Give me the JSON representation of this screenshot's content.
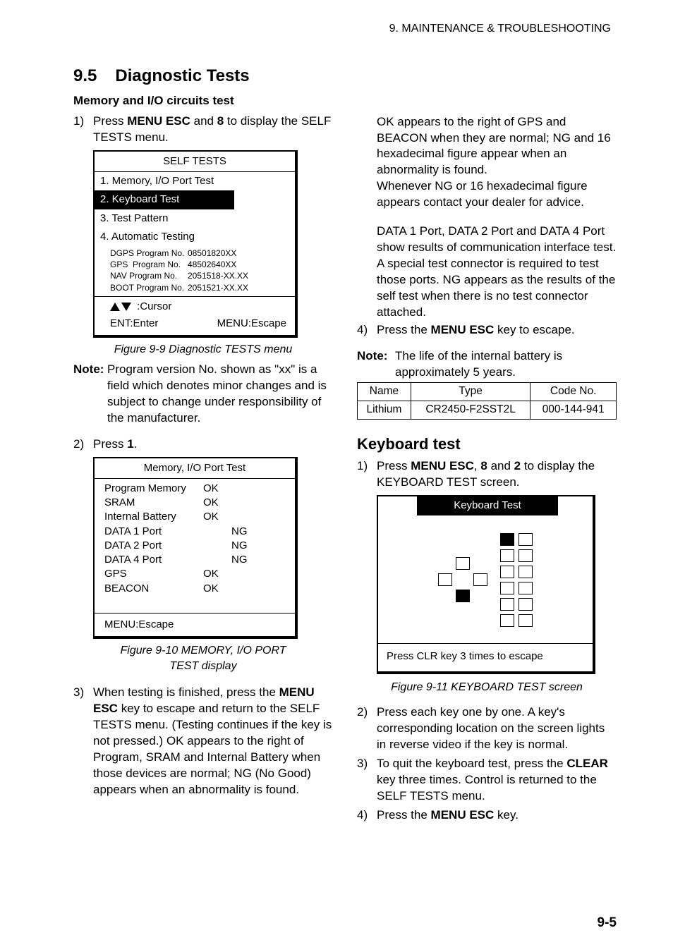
{
  "header": "9. MAINTENANCE & TROUBLESHOOTING",
  "section": {
    "num": "9.5",
    "title": "Diagnostic Tests"
  },
  "sub_mem": "Memory and I/O circuits test",
  "left": {
    "step1_a": "Press ",
    "step1_b": "MENU ESC",
    "step1_c": " and ",
    "step1_d": "8",
    "step1_e": " to display the SELF TESTS menu.",
    "fig9_9": "Figure 9-9 Diagnostic TESTS menu",
    "note1_label": "Note:",
    "note1_body": "Program version No. shown as \"xx\" is a field which denotes minor changes and is subject to change under responsibility of the manufacturer.",
    "step2_a": "Press ",
    "step2_b": "1",
    "step2_c": ".",
    "fig9_10a": "Figure 9-10 MEMORY, I/O PORT",
    "fig9_10b": "TEST display",
    "step3_a": "When testing is finished, press the ",
    "step3_b": "MENU ESC",
    "step3_c": " key to escape and return to the SELF TESTS menu. (Testing continues if the key is not pressed.) OK appears to the right of Program, SRAM and Internal Battery when those devices are normal; NG (No Good) appears when an abnormality is found."
  },
  "self_tests": {
    "title": "SELF TESTS",
    "items": [
      "1. Memory, I/O Port Test",
      "2. Keyboard Test",
      "3. Test Pattern",
      "4. Automatic Testing"
    ],
    "progs": [
      {
        "l": "DGPS Program No.",
        "r": "08501820XX"
      },
      {
        "l": "GPS  Program No.",
        "r": "48502640XX"
      },
      {
        "l": "NAV Program No.",
        "r": "2051518-XX.XX"
      },
      {
        "l": "BOOT Program No.",
        "r": "2051521-XX.XX"
      }
    ],
    "cursor": ":Cursor",
    "ent": "ENT:Enter",
    "esc": "MENU:Escape"
  },
  "mio": {
    "title": "Memory, I/O Port Test",
    "rows": [
      {
        "l": "Program Memory",
        "ok": "OK",
        "ng": ""
      },
      {
        "l": "SRAM",
        "ok": "OK",
        "ng": ""
      },
      {
        "l": "Internal Battery",
        "ok": "OK",
        "ng": ""
      },
      {
        "l": "DATA 1 Port",
        "ok": "",
        "ng": "NG"
      },
      {
        "l": "DATA 2 Port",
        "ok": "",
        "ng": "NG"
      },
      {
        "l": "DATA 4 Port",
        "ok": "",
        "ng": "NG"
      },
      {
        "l": "GPS",
        "ok": "OK",
        "ng": ""
      },
      {
        "l": "BEACON",
        "ok": "OK",
        "ng": ""
      }
    ],
    "foot": "MENU:Escape"
  },
  "right": {
    "cont1": "OK appears to the right of GPS and BEACON when they are normal; NG and 16 hexadecimal figure appear when an abnormality is found.",
    "cont2": "Whenever NG or 16 hexadecimal figure appears contact your dealer for advice.",
    "cont3": "DATA 1 Port, DATA 2 Port and DATA 4 Port show results of communication interface test. A special test connector is required to test those ports. NG appears as the results of the self test when there is no test connector attached.",
    "step4_a": "Press the ",
    "step4_b": "MENU ESC",
    "step4_c": " key to escape.",
    "note_label": "Note:",
    "note_body": "The life of the internal battery is approximately 5 years.",
    "bat": {
      "h1": "Name",
      "h2": "Type",
      "h3": "Code No.",
      "r1": "Lithium",
      "r2": "CR2450-F2SST2L",
      "r3": "000-144-941"
    },
    "kb_title": "Keyboard test",
    "kstep1_a": "Press ",
    "kstep1_b": "MENU ESC",
    "kstep1_c": ", ",
    "kstep1_d": "8",
    "kstep1_e": " and ",
    "kstep1_f": "2",
    "kstep1_g": " to display the KEYBOARD TEST screen.",
    "kbt_title": "Keyboard Test",
    "kbt_foot": "Press CLR key 3 times to escape",
    "fig9_11": "Figure 9-11 KEYBOARD TEST screen",
    "kstep2": "Press each key one by one. A key's corresponding location on the screen lights in reverse video if the key is normal.",
    "kstep3_a": "To quit the keyboard test, press the ",
    "kstep3_b": "CLEAR",
    "kstep3_c": " key three times. Control is returned to the SELF TESTS menu.",
    "kstep4_a": "Press the ",
    "kstep4_b": "MENU ESC",
    "kstep4_c": " key."
  },
  "page_num": "9-5"
}
